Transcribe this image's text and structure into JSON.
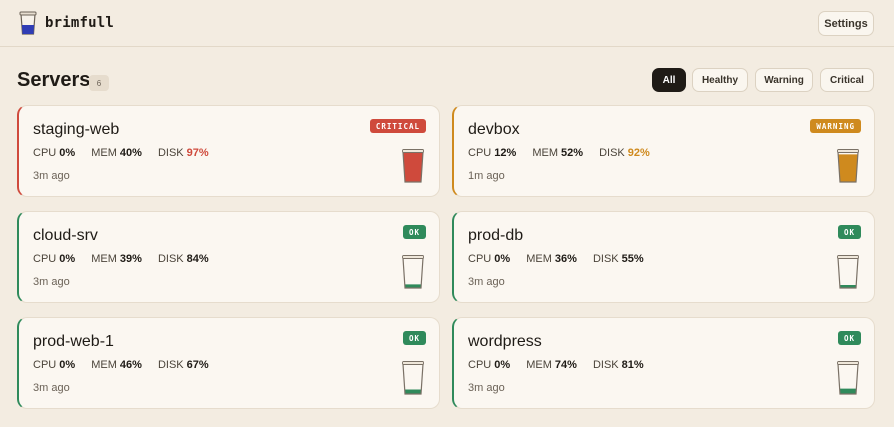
{
  "app": {
    "name": "brimfull",
    "logo_icon": "cup-logo-icon"
  },
  "header": {
    "settings_label": "Settings"
  },
  "page": {
    "title": "Servers",
    "count": "6"
  },
  "filters": [
    {
      "label": "All",
      "active": true
    },
    {
      "label": "Healthy",
      "active": false
    },
    {
      "label": "Warning",
      "active": false
    },
    {
      "label": "Critical",
      "active": false
    }
  ],
  "metric_labels": {
    "cpu": "CPU",
    "mem": "MEM",
    "disk": "DISK"
  },
  "colors": {
    "critical": "#cf4a3c",
    "warning": "#cf8a1e",
    "ok": "#2f8a5b",
    "background": "#f3ece1"
  },
  "servers": [
    {
      "name": "staging-web",
      "status": "CRITICAL",
      "cpu": "0%",
      "mem": "40%",
      "disk": "97%",
      "disk_state": "critical",
      "ago": "3m ago",
      "fill": 0.97
    },
    {
      "name": "devbox",
      "status": "WARNING",
      "cpu": "12%",
      "mem": "52%",
      "disk": "92%",
      "disk_state": "warning",
      "ago": "1m ago",
      "fill": 0.92
    },
    {
      "name": "cloud-srv",
      "status": "OK",
      "cpu": "0%",
      "mem": "39%",
      "disk": "84%",
      "disk_state": "ok",
      "ago": "3m ago",
      "fill": 0.12
    },
    {
      "name": "prod-db",
      "status": "OK",
      "cpu": "0%",
      "mem": "36%",
      "disk": "55%",
      "disk_state": "ok",
      "ago": "3m ago",
      "fill": 0.1
    },
    {
      "name": "prod-web-1",
      "status": "OK",
      "cpu": "0%",
      "mem": "46%",
      "disk": "67%",
      "disk_state": "ok",
      "ago": "3m ago",
      "fill": 0.15
    },
    {
      "name": "wordpress",
      "status": "OK",
      "cpu": "0%",
      "mem": "74%",
      "disk": "81%",
      "disk_state": "ok",
      "ago": "3m ago",
      "fill": 0.18
    }
  ]
}
